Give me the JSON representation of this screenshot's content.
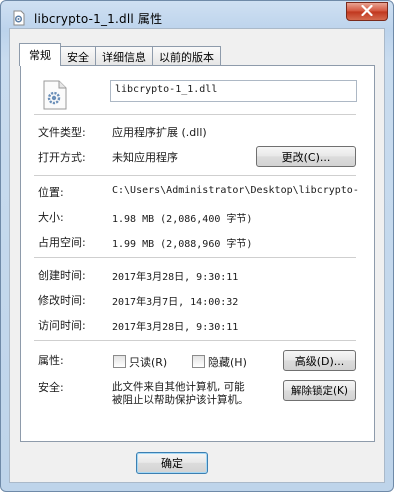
{
  "window": {
    "title": "libcrypto-1_1.dll 属性"
  },
  "tabs": [
    {
      "label": "常规",
      "active": true
    },
    {
      "label": "安全",
      "active": false
    },
    {
      "label": "详细信息",
      "active": false
    },
    {
      "label": "以前的版本",
      "active": false
    }
  ],
  "file": {
    "name": "libcrypto-1_1.dll",
    "icon": "dll-file-icon"
  },
  "type_section": {
    "file_type_label": "文件类型:",
    "file_type_value": "应用程序扩展 (.dll)",
    "opens_with_label": "打开方式:",
    "opens_with_value": "未知应用程序",
    "change_button": "更改(C)..."
  },
  "location_section": {
    "location_label": "位置:",
    "location_value": "C:\\Users\\Administrator\\Desktop\\libcrypto-",
    "size_label": "大小:",
    "size_value": "1.98 MB (2,086,400 字节)",
    "disk_size_label": "占用空间:",
    "disk_size_value": "1.99 MB (2,088,960 字节)"
  },
  "dates_section": {
    "created_label": "创建时间:",
    "created_value": "2017年3月28日, 9:30:11",
    "modified_label": "修改时间:",
    "modified_value": "2017年3月7日, 14:00:32",
    "accessed_label": "访问时间:",
    "accessed_value": "2017年3月28日, 9:30:11"
  },
  "attributes_section": {
    "attributes_label": "属性:",
    "readonly_label": "只读(R)",
    "readonly_checked": false,
    "hidden_label": "隐藏(H)",
    "hidden_checked": false,
    "advanced_button": "高级(D)...",
    "security_label": "安全:",
    "security_text_line1": "此文件来自其他计算机, 可能",
    "security_text_line2": "被阻止以帮助保护该计算机。",
    "unblock_button": "解除锁定(K)"
  },
  "footer": {
    "ok_button": "确定"
  },
  "colors": {
    "accent": "#3c7fb1",
    "close": "#c0361d",
    "frame": "#bcd3ec"
  }
}
